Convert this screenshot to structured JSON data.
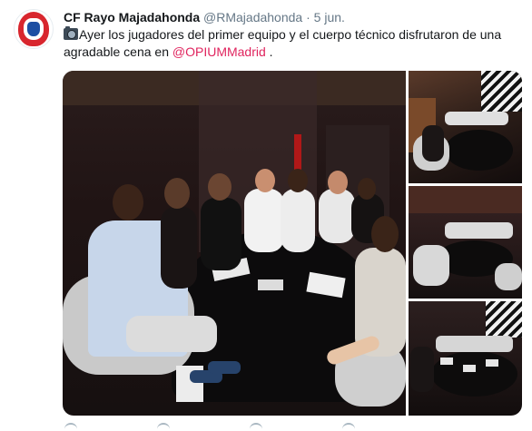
{
  "account": {
    "name": "CF Rayo Majadahonda",
    "handle": "@RMajadahonda",
    "separator": "·",
    "date": "5 jun."
  },
  "tweet": {
    "text_before": "Ayer los jugadores del primer equipo y el cuerpo técnico disfrutaron de una agradable cena en ",
    "mention": "@OPIUMMadrid",
    "text_after": " ."
  },
  "icons": {
    "avatar": "club-crest-icon",
    "emoji": "camera-icon",
    "actions": [
      "reply-icon",
      "retweet-icon",
      "like-icon",
      "message-icon"
    ]
  },
  "colors": {
    "mention": "#e0245e",
    "secondary_text": "#657786",
    "crest_red": "#d8262e",
    "crest_blue": "#1d4fa3"
  }
}
